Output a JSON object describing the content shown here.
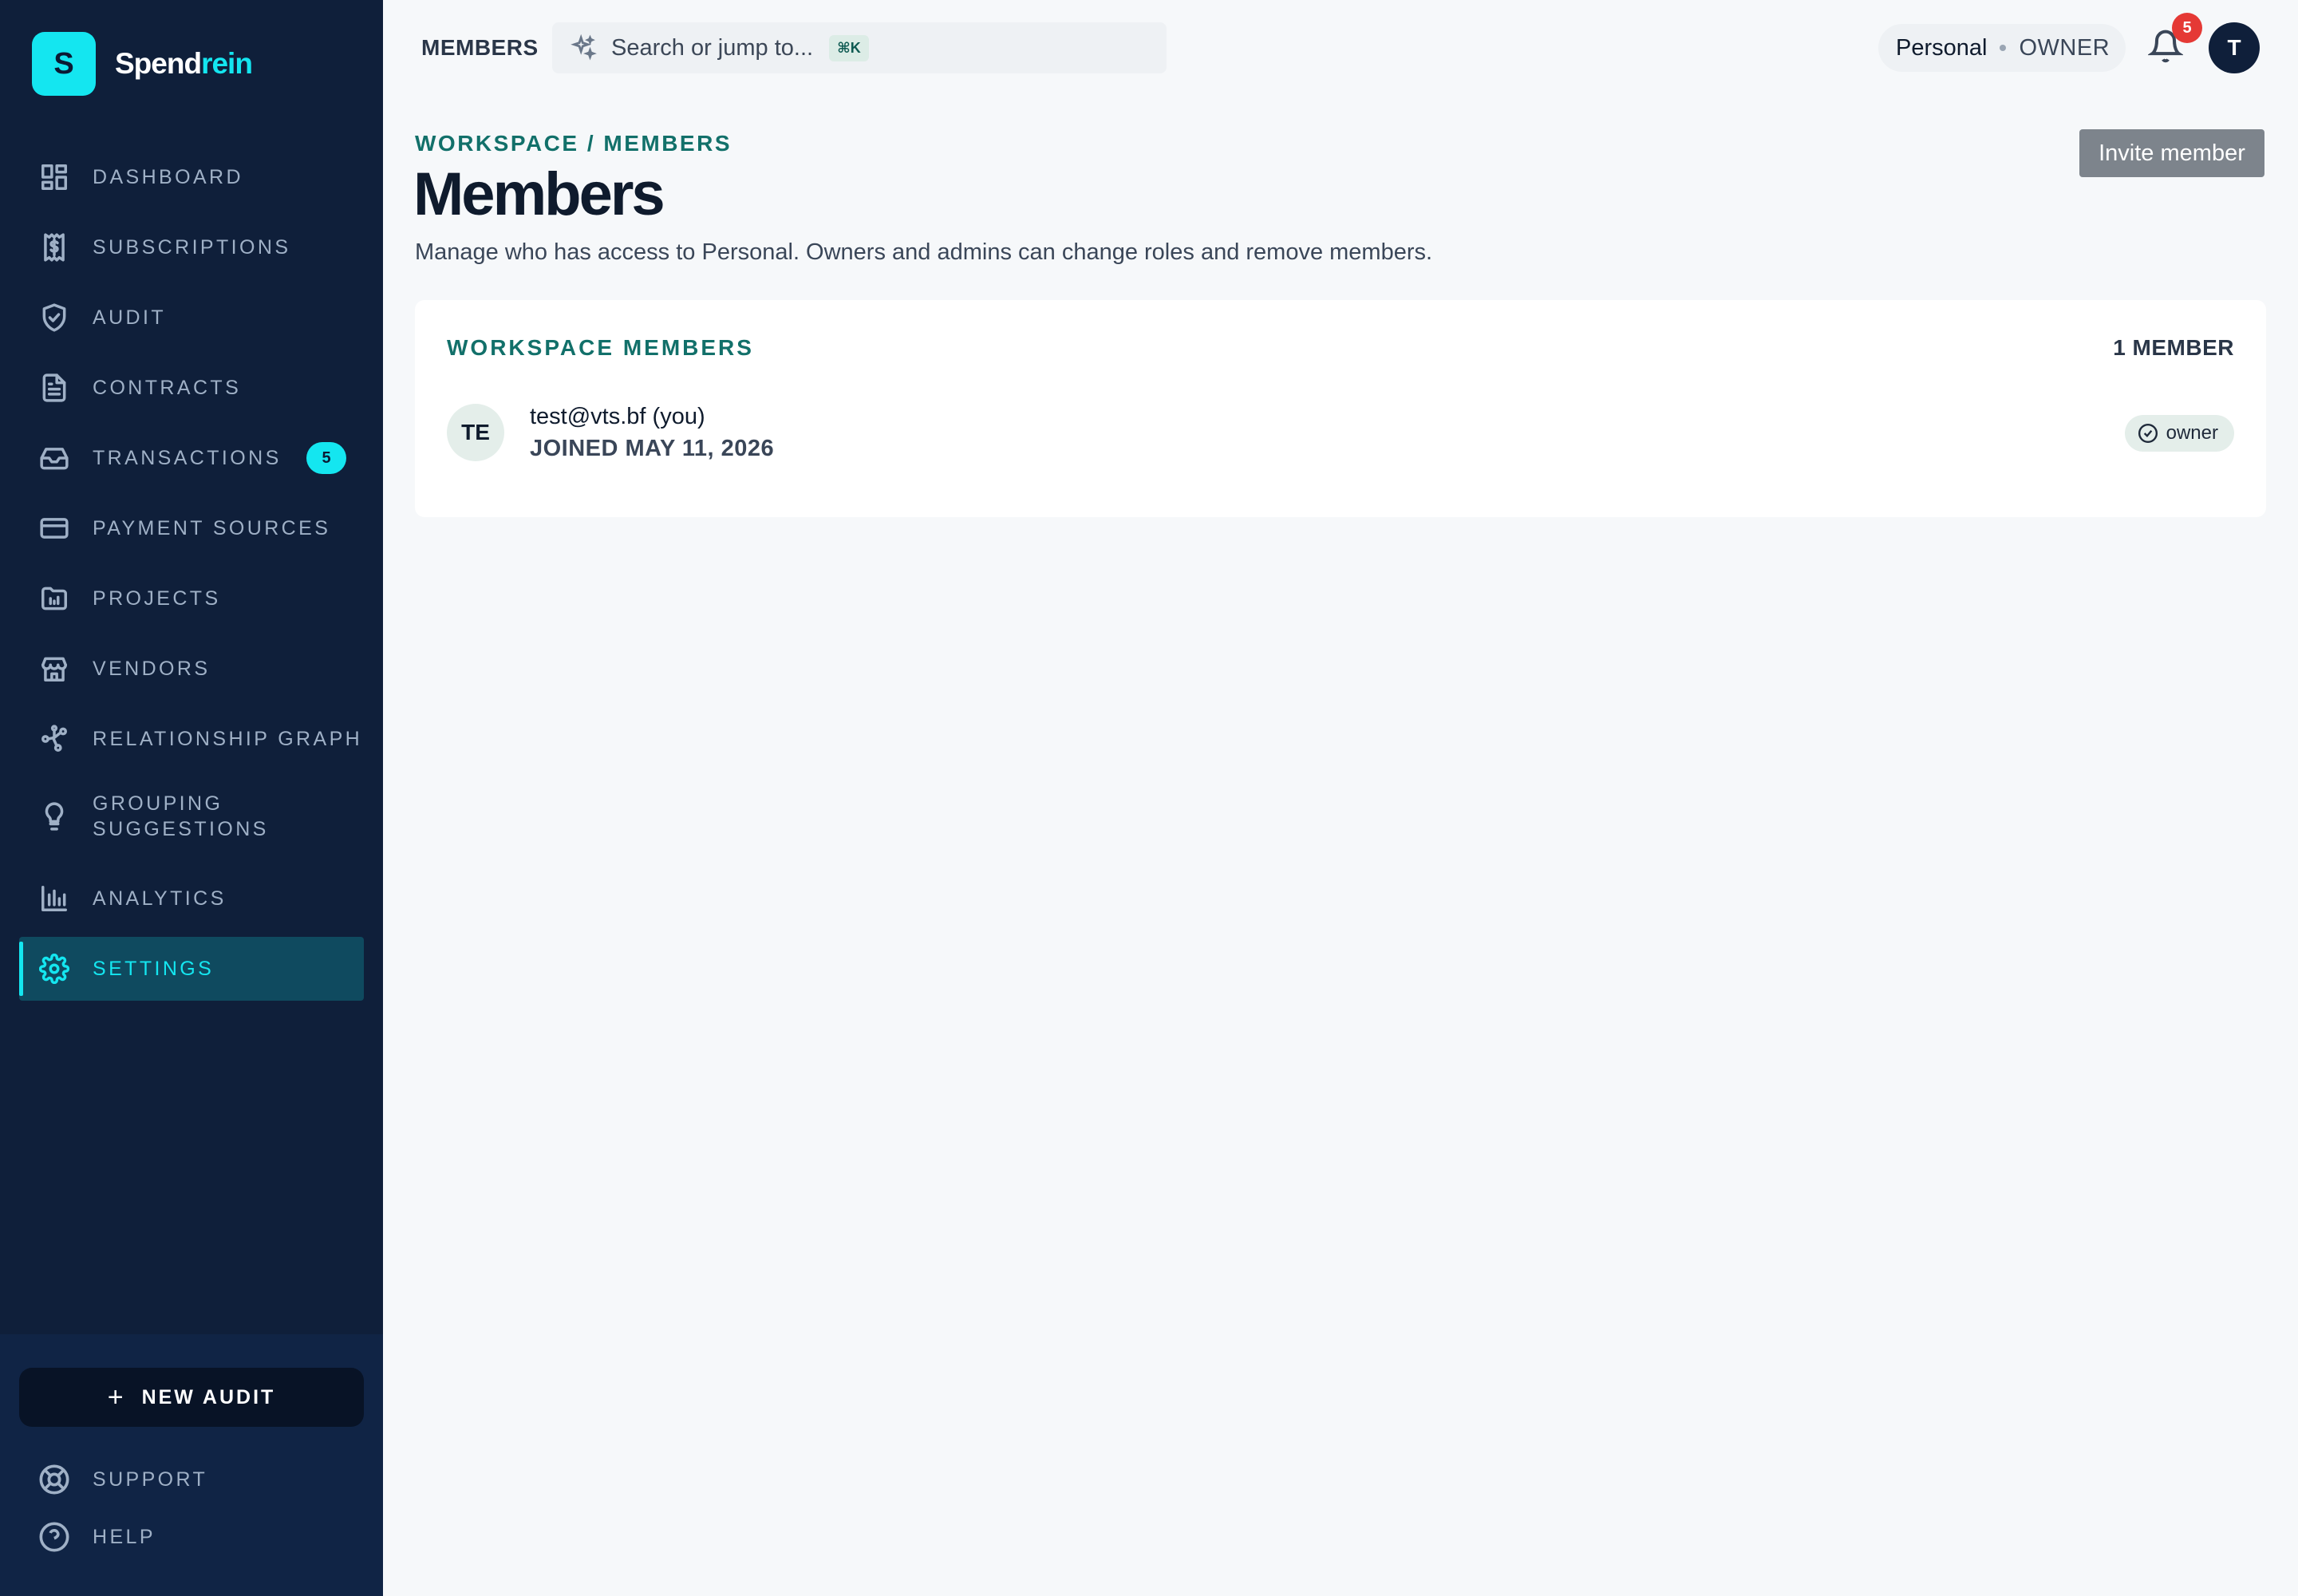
{
  "brand": {
    "logo_letter": "S",
    "name_part1": "Spend",
    "name_part2": "rein",
    "accent_color": "#14e6f0"
  },
  "sidebar": {
    "items": [
      {
        "label": "DASHBOARD",
        "icon": "dashboard-icon"
      },
      {
        "label": "SUBSCRIPTIONS",
        "icon": "receipt-dollar-icon"
      },
      {
        "label": "AUDIT",
        "icon": "shield-check-icon"
      },
      {
        "label": "CONTRACTS",
        "icon": "document-icon"
      },
      {
        "label": "TRANSACTIONS",
        "icon": "inbox-icon",
        "badge": "5"
      },
      {
        "label": "PAYMENT SOURCES",
        "icon": "credit-card-icon"
      },
      {
        "label": "PROJECTS",
        "icon": "folder-chart-icon"
      },
      {
        "label": "VENDORS",
        "icon": "store-icon"
      },
      {
        "label": "RELATIONSHIP GRAPH",
        "icon": "graph-icon"
      },
      {
        "label": "GROUPING SUGGESTIONS",
        "label_line1": "GROUPING",
        "label_line2": "SUGGESTIONS",
        "icon": "lightbulb-icon"
      },
      {
        "label": "ANALYTICS",
        "icon": "bar-chart-icon"
      },
      {
        "label": "SETTINGS",
        "icon": "gear-icon",
        "active": true
      }
    ],
    "new_audit_label": "NEW AUDIT",
    "support_label": "SUPPORT",
    "help_label": "HELP"
  },
  "topbar": {
    "title": "MEMBERS",
    "search_placeholder": "Search or jump to...",
    "search_shortcut": "⌘K",
    "workspace_name": "Personal",
    "workspace_role": "OWNER",
    "notification_count": "5",
    "user_initial": "T"
  },
  "page": {
    "breadcrumb": "WORKSPACE / MEMBERS",
    "title": "Members",
    "description": "Manage who has access to Personal. Owners and admins can change roles and remove members.",
    "invite_label": "Invite member"
  },
  "members_card": {
    "title": "WORKSPACE MEMBERS",
    "count": "1 MEMBER",
    "members": [
      {
        "initials": "TE",
        "email": "test@vts.bf (you)",
        "joined": "JOINED MAY 11, 2026",
        "role": "owner"
      }
    ]
  }
}
